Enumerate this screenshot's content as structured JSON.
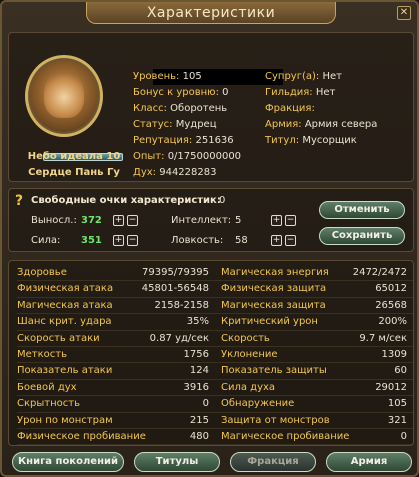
{
  "window": {
    "title": "Характеристики",
    "close_icon": "✕"
  },
  "profile": {
    "name_line1": "Небо идеала 10",
    "name_line2": "Сердце Пань Гу",
    "left": [
      {
        "label": "Уровень:",
        "value": "105"
      },
      {
        "label": "Бонус к уровню:",
        "value": "0"
      },
      {
        "label": "Класс:",
        "value": "Оборотень"
      },
      {
        "label": "Статус:",
        "value": "Мудрец"
      },
      {
        "label": "Репутация:",
        "value": "251636"
      },
      {
        "label": "Опыт:",
        "value": "0/1750000000"
      },
      {
        "label": "Дух:",
        "value": "944228283"
      }
    ],
    "right": [
      {
        "label": "Супруг(а):",
        "value": "Нет"
      },
      {
        "label": "Гильдия:",
        "value": "Нет"
      },
      {
        "label": "Фракция:",
        "value": ""
      },
      {
        "label": "Армия:",
        "value": "Армия севера"
      },
      {
        "label": "Титул:",
        "value": "Мусорщик"
      }
    ]
  },
  "points": {
    "free_label": "Свободные очки характеристик:",
    "free_value": "0",
    "vynosl_label": "Выносл.:",
    "vynosl_value": "372",
    "sila_label": "Сила:",
    "sila_value": "351",
    "intellect_label": "Интеллект:",
    "intellect_value": "5",
    "lovkost_label": "Ловкость:",
    "lovkost_value": "58",
    "plus": "+",
    "minus": "−",
    "cancel_label": "Отменить",
    "save_label": "Сохранить"
  },
  "stats": [
    {
      "left_label": "Здоровье",
      "left_value": "79395/79395",
      "right_label": "Магическая энергия",
      "right_value": "2472/2472"
    },
    {
      "left_label": "Физическая атака",
      "left_value": "45801-56548",
      "right_label": "Физическая защита",
      "right_value": "65012"
    },
    {
      "left_label": "Магическая атака",
      "left_value": "2158-2158",
      "right_label": "Магическая защита",
      "right_value": "26568"
    },
    {
      "left_label": "Шанс крит. удара",
      "left_value": "35%",
      "right_label": "Критический урон",
      "right_value": "200%"
    },
    {
      "left_label": "Скорость атаки",
      "left_value": "0.87 уд/сек",
      "right_label": "Скорость",
      "right_value": "9.7 м/сек"
    },
    {
      "left_label": "Меткость",
      "left_value": "1756",
      "right_label": "Уклонение",
      "right_value": "1309"
    },
    {
      "left_label": "Показатель атаки",
      "left_value": "124",
      "right_label": "Показатель защиты",
      "right_value": "60"
    },
    {
      "left_label": "Боевой дух",
      "left_value": "3916",
      "right_label": "Сила духа",
      "right_value": "29012"
    },
    {
      "left_label": "Скрытность",
      "left_value": "0",
      "right_label": "Обнаружение",
      "right_value": "105"
    },
    {
      "left_label": "Урон по монстрам",
      "left_value": "215",
      "right_label": "Защита от монстров",
      "right_value": "321"
    },
    {
      "left_label": "Физическое пробивание",
      "left_value": "480",
      "right_label": "Магическое пробивание",
      "right_value": "0"
    }
  ],
  "tabs": [
    {
      "label": "Книга поколений",
      "disabled": false
    },
    {
      "label": "Титулы",
      "disabled": false
    },
    {
      "label": "Фракция",
      "disabled": true
    },
    {
      "label": "Армия",
      "disabled": false
    }
  ]
}
